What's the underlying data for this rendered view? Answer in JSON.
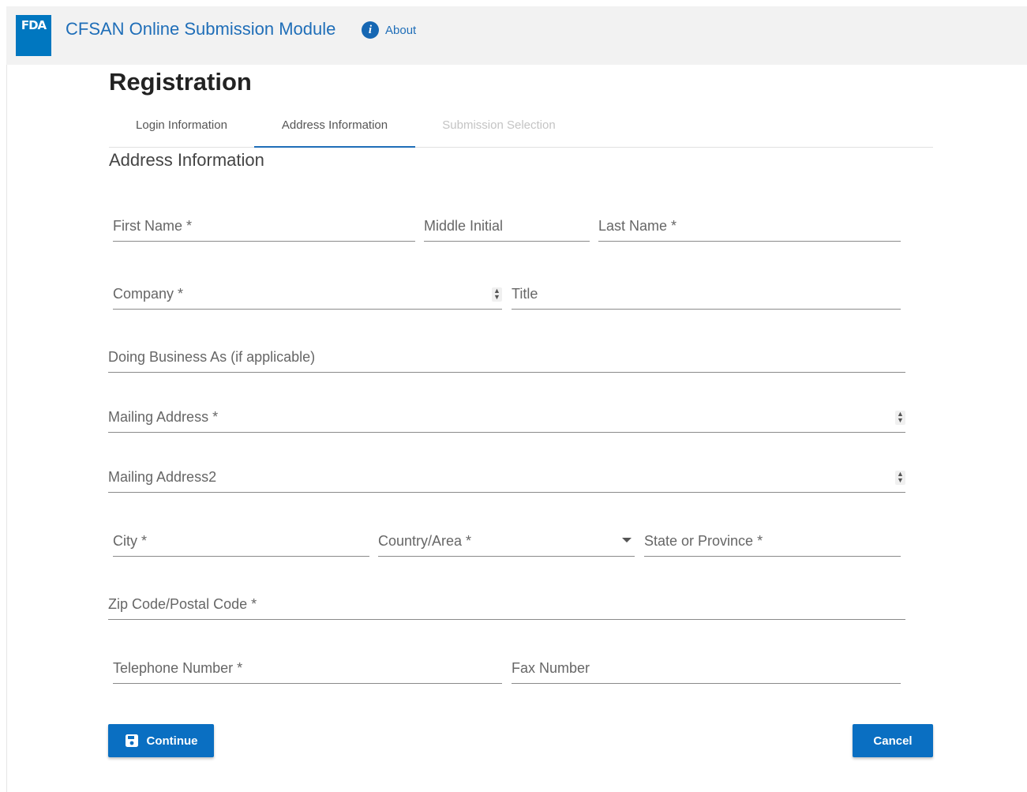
{
  "header": {
    "logo_text": "FDA",
    "app_title": "CFSAN Online Submission Module",
    "about_label": "About",
    "about_icon": "info-icon"
  },
  "page": {
    "title": "Registration",
    "section_title": "Address Information"
  },
  "tabs": [
    {
      "label": "Login Information",
      "state": "default"
    },
    {
      "label": "Address Information",
      "state": "active"
    },
    {
      "label": "Submission Selection",
      "state": "disabled"
    }
  ],
  "form": {
    "first_name": {
      "label": "First Name *",
      "value": ""
    },
    "middle_initial": {
      "label": "Middle Initial",
      "value": ""
    },
    "last_name": {
      "label": "Last Name *",
      "value": ""
    },
    "company": {
      "label": "Company *",
      "value": ""
    },
    "title": {
      "label": "Title",
      "value": ""
    },
    "dba": {
      "label": "Doing Business As (if applicable)",
      "value": ""
    },
    "mailing_address": {
      "label": "Mailing Address *",
      "value": ""
    },
    "mailing_address2": {
      "label": "Mailing Address2",
      "value": ""
    },
    "city": {
      "label": "City *",
      "value": ""
    },
    "country": {
      "label": "Country/Area *",
      "value": ""
    },
    "state": {
      "label": "State or Province *",
      "value": ""
    },
    "zip": {
      "label": "Zip Code/Postal Code *",
      "value": ""
    },
    "telephone": {
      "label": "Telephone Number *",
      "value": ""
    },
    "fax": {
      "label": "Fax Number",
      "value": ""
    }
  },
  "buttons": {
    "continue_label": "Continue",
    "continue_icon": "save-icon",
    "cancel_label": "Cancel"
  },
  "colors": {
    "brand_blue": "#0077c0",
    "link_blue": "#1f6eb8",
    "button_blue": "#0a6fc2",
    "header_bg": "#f2f2f2"
  }
}
